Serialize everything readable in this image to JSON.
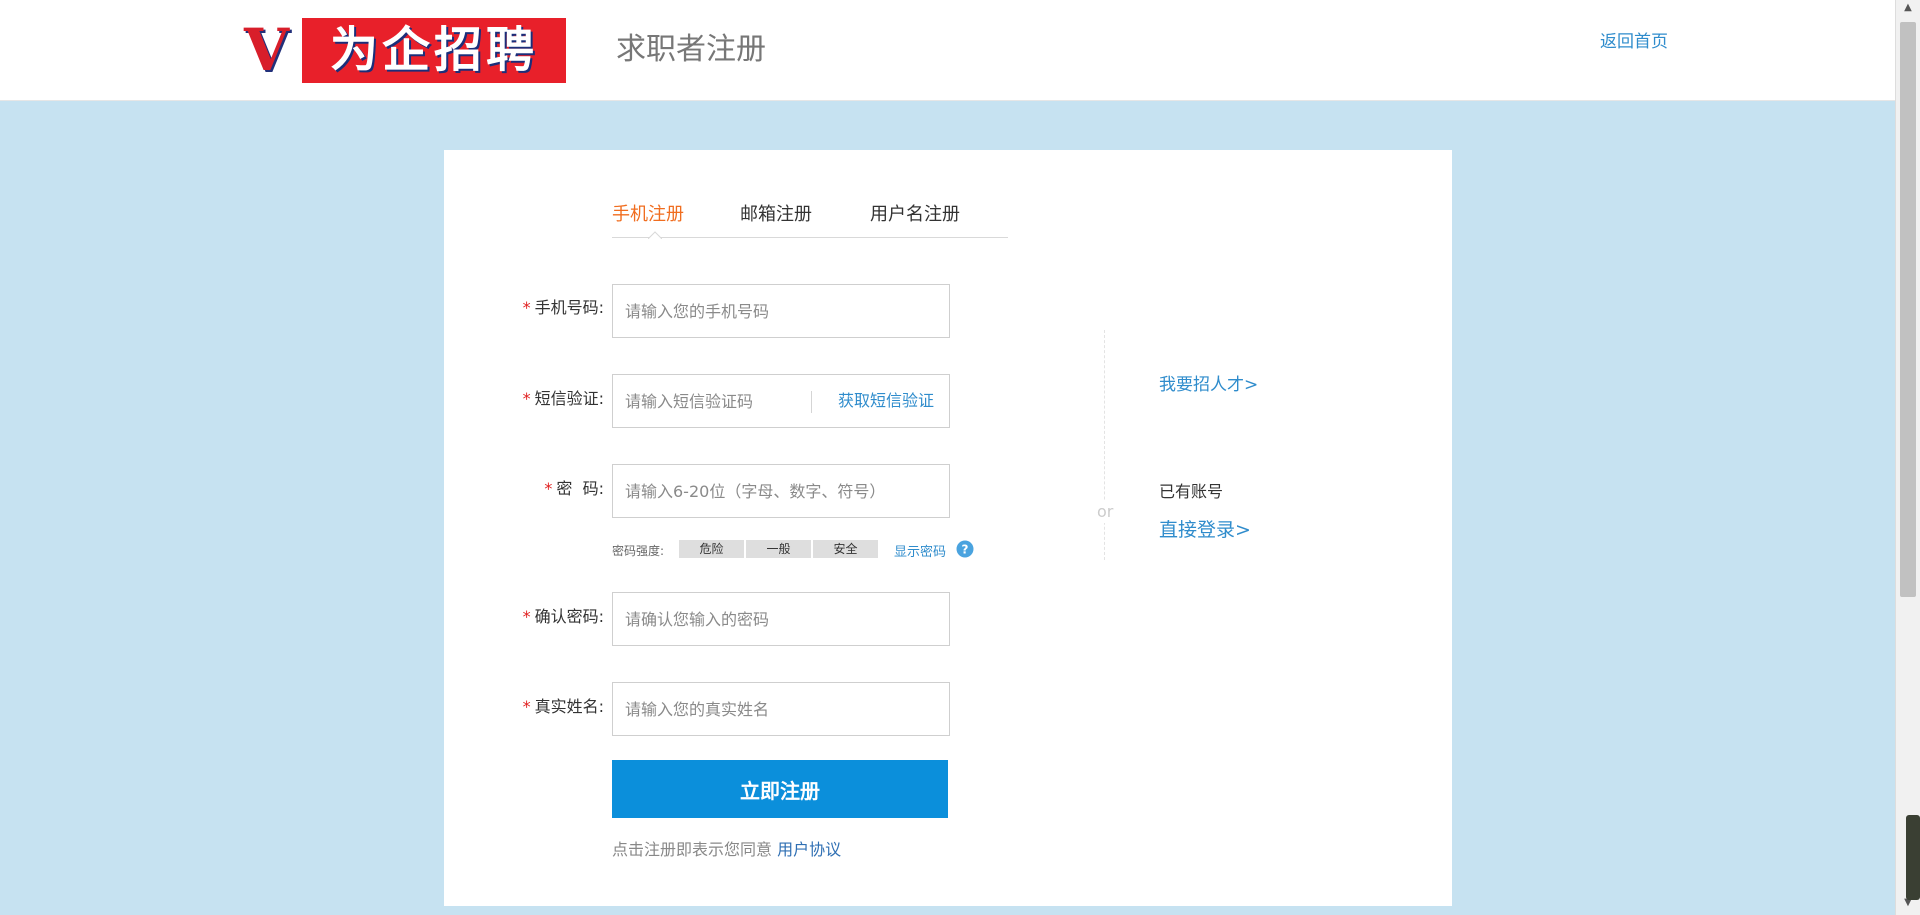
{
  "header": {
    "logo_letter": "V",
    "logo_text": "为企招聘",
    "page_title": "求职者注册",
    "back_home": "返回首页"
  },
  "tabs": [
    {
      "label": "手机注册",
      "active": true
    },
    {
      "label": "邮箱注册",
      "active": false
    },
    {
      "label": "用户名注册",
      "active": false
    }
  ],
  "form": {
    "phone": {
      "label": "手机号码:",
      "placeholder": "请输入您的手机号码"
    },
    "sms": {
      "label": "短信验证:",
      "placeholder": "请输入短信验证码",
      "button": "获取短信验证"
    },
    "password": {
      "label": "密  码:",
      "placeholder": "请输入6-20位（字母、数字、符号）"
    },
    "strength": {
      "label": "密码强度:",
      "levels": [
        "危险",
        "一般",
        "安全"
      ],
      "show_password": "显示密码",
      "help_icon": "question-icon"
    },
    "confirm": {
      "label": "确认密码:",
      "placeholder": "请确认您输入的密码"
    },
    "realname": {
      "label": "真实姓名:",
      "placeholder": "请输入您的真实姓名"
    },
    "required_mark": "*",
    "submit": "立即注册",
    "agree_text": "点击注册即表示您同意",
    "agree_link": "用户协议"
  },
  "side": {
    "or": "or",
    "recruit": "我要招人才>",
    "has_account": "已有账号",
    "login": "直接登录>"
  },
  "colors": {
    "background": "#c6e2f1",
    "accent": "#0b8fdb",
    "link": "#2f8ccc",
    "active_tab": "#f06d1f",
    "required": "#e02020"
  }
}
